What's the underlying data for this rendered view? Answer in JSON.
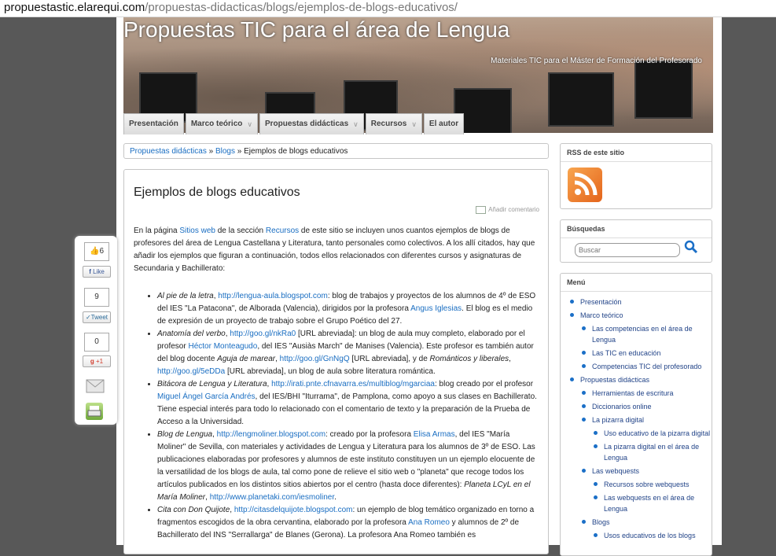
{
  "browser": {
    "url_host": "propuestastic.elarequi.com",
    "url_path": "/propuestas-didacticas/blogs/ejemplos-de-blogs-educativos/"
  },
  "header": {
    "title": "Propuestas TIC para el área de Lengua",
    "subtitle": "Materiales TIC para el Máster de Formación del Profesorado"
  },
  "nav": [
    {
      "label": "Presentación"
    },
    {
      "label": "Marco teórico"
    },
    {
      "label": "Propuestas didácticas"
    },
    {
      "label": "Recursos"
    },
    {
      "label": "El autor"
    }
  ],
  "breadcrumb": {
    "crumb1": "Propuestas didácticas",
    "sep": "»",
    "crumb2": "Blogs",
    "current": "Ejemplos de blogs educativos"
  },
  "article": {
    "title": "Ejemplos de blogs educativos",
    "add_comment": "Añadir comentario",
    "intro": {
      "t1": "En la página ",
      "l1": "Sitios web",
      "t2": " de la sección ",
      "l2": "Recursos",
      "t3": " de este sitio se incluyen unos cuantos ejemplos de blogs de profesores del área de Lengua Castellana y Literatura, tanto personales como colectivos. A los allí citados, hay que añadir los ejemplos que figuran a continuación, todos ellos relacionados con diferentes cursos y asignaturas de Secundaria y Bachillerato:"
    },
    "items": [
      {
        "name": "Al pie de la letra",
        "link": "http://lengua-aula.blogspot.com",
        "t1": ": blog de trabajos y proyectos de los alumnos de 4º de ESO del IES \"La Patacona\", de Alborada (Valencia), dirigidos por la profesora ",
        "person": "Angus Iglesias",
        "t2": ". El blog es el medio de expresión de un proyecto de trabajo sobre el Grupo Poético del 27."
      },
      {
        "name": "Anatomía del verbo",
        "link": "http://goo.gl/nkRa0",
        "t1": " [URL abreviada]: un blog de aula muy completo, elaborado por el profesor ",
        "person": "Héctor Monteagudo",
        "t2": ", del IES \"Ausiàs March\" de Manises (Valencia). Este profesor es también autor del blog docente ",
        "em2": "Aguja de marear",
        "t3": ", ",
        "link2": "http://goo.gl/GnNgQ",
        "t4": " [URL abreviada], y de ",
        "em3": "Románticos y liberales",
        "t5": ", ",
        "link3": "http://goo.gl/5eDDa",
        "t6": " [URL abreviada], un blog de aula sobre literatura romántica."
      },
      {
        "name": "Bitácora de Lengua y Literatura",
        "link": "http://irati.pnte.cfnavarra.es/multiblog/mgarciaa",
        "t1": ": blog creado por el profesor ",
        "person": "Miguel Ángel García Andrés",
        "t2": ", del IES/BHI \"Iturrama\", de Pamplona, como apoyo a sus clases en Bachillerato. Tiene especial interés para todo lo relacionado con el comentario de texto y la preparación de la Prueba de Acceso a la Universidad."
      },
      {
        "name": "Blog de Lengua",
        "link": "http://lengmoliner.blogspot.com",
        "t1": ": creado por la profesora ",
        "person": "Elisa Armas",
        "t2": ", del IES \"María Moliner\" de Sevilla, con materiales y actividades de Lengua y Literatura para los alumnos de 3º de ESO. Las publicaciones elaboradas por profesores y alumnos de este instituto constituyen un un ejemplo elocuente de la versatilidad de los blogs de aula, tal como pone de relieve el sitio web o \"planeta\" que recoge todos los artículos publicados en los distintos sitios abiertos por el centro (hasta doce diferentes): ",
        "em2": "Planeta LCyL en el María Moliner",
        "t3": ", ",
        "link2": "http://www.planetaki.com/iesmoliner",
        "t4": "."
      },
      {
        "name": "Cita con Don Quijote",
        "link": "http://citasdelquijote.blogspot.com",
        "t1": ": un ejemplo de blog temático organizado en torno a fragmentos escogidos de la obra cervantina, elaborado por la profesora ",
        "person": "Ana Romeo",
        "t2": " y alumnos de 2º de Bachillerato del INS \"Serrallarga\" de Blanes (Gerona). La profesora Ana Romeo también es"
      }
    ]
  },
  "sidebar": {
    "rss_title": "RSS de este sitio",
    "search_title": "Búsquedas",
    "search_placeholder": "Buscar",
    "menu_title": "Menú",
    "menu": {
      "presentacion": "Presentación",
      "marco": "Marco teórico",
      "marco_1": "Las competencias en el área de Lengua",
      "marco_2": "Las TIC en educación",
      "marco_3": "Competencias TIC del profesorado",
      "propuestas": "Propuestas didácticas",
      "prop_1": "Herramientas de escritura",
      "prop_2": "Diccionarios online",
      "prop_3": "La pizarra digital",
      "prop_3_1": "Uso educativo de la pizarra digital",
      "prop_3_2": "La pizarra digital en el área de Lengua",
      "prop_4": "Las webquests",
      "prop_4_1": "Recursos sobre webquests",
      "prop_4_2": "Las webquests en el área de Lengua",
      "prop_5": "Blogs",
      "prop_5_1": "Usos educativos de los blogs"
    }
  },
  "share": {
    "like_count": "6",
    "like_label": "Like",
    "tweet_count": "9",
    "tweet_label": "Tweet",
    "plus_count": "0",
    "plus_label": "+1"
  }
}
